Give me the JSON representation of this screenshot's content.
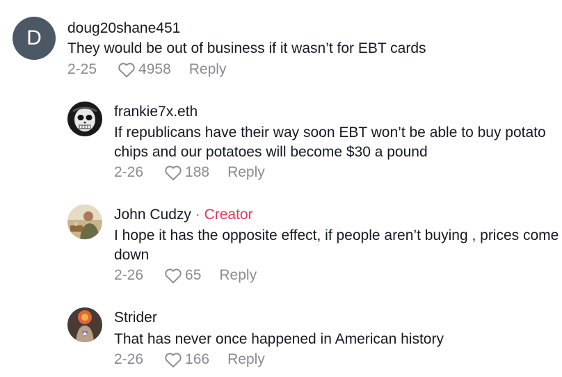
{
  "comments": [
    {
      "avatar_letter": "D",
      "username": "doug20shane451",
      "text": "They would be out of business if it wasn’t for EBT cards",
      "date": "2-25",
      "likes": "4958",
      "reply_label": "Reply",
      "avatar_icon": "letter-avatar"
    },
    {
      "username": "frankie7x.eth",
      "text": "If republicans have their way soon EBT won’t be able to buy potato chips and our potatoes will become $30 a pound",
      "date": "2-26",
      "likes": "188",
      "reply_label": "Reply",
      "avatar_icon": "skull-mask-avatar"
    },
    {
      "username": "John Cudzy",
      "creator_label": " · Creator",
      "text": "I hope it has the opposite effect, if people aren’t buying , prices come down",
      "date": "2-26",
      "likes": "65",
      "reply_label": "Reply",
      "avatar_icon": "person-photo-avatar"
    },
    {
      "username": "Strider",
      "text": "That has never once happened in American history",
      "date": "2-26",
      "likes": "166",
      "reply_label": "Reply",
      "avatar_icon": "cartoon-bird-avatar"
    }
  ],
  "colors": {
    "text": "#161823",
    "meta": "#8a8b91",
    "creator": "#e8375b",
    "letter_avatar_bg": "#4d5866"
  }
}
